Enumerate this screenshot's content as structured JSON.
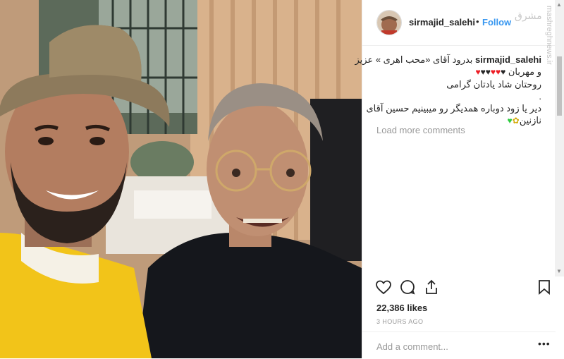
{
  "post": {
    "username": "sirmajid_salehi",
    "follow_label": "Follow",
    "dot": "•",
    "watermark": "مشرق",
    "side_watermark": "mashreghnews.ir",
    "caption": {
      "line1_text": "بدرود آقای «محب اهری » عزیز",
      "line2_text": "و مهربان",
      "line3_text": "روحتان شاد یادتان گرامی",
      "line4_text": ".",
      "line5_text": "دیر یا زود دوباره همدیگر رو میبینیم حسین آقای",
      "line6_text": "نازنین"
    },
    "load_more_label": "Load more comments",
    "likes": "22,386 likes",
    "time": "3 HOURS AGO",
    "comment_placeholder": "Add a comment...",
    "more_label": "•••"
  },
  "colors": {
    "follow_blue": "#3897f0",
    "heart_red": "#ed1c24",
    "heart_black": "#262626",
    "heart_green": "#2ecc40",
    "heart_yellow": "#f4d03f"
  },
  "icons": [
    "heart-icon",
    "comment-icon",
    "share-icon",
    "bookmark-icon"
  ]
}
